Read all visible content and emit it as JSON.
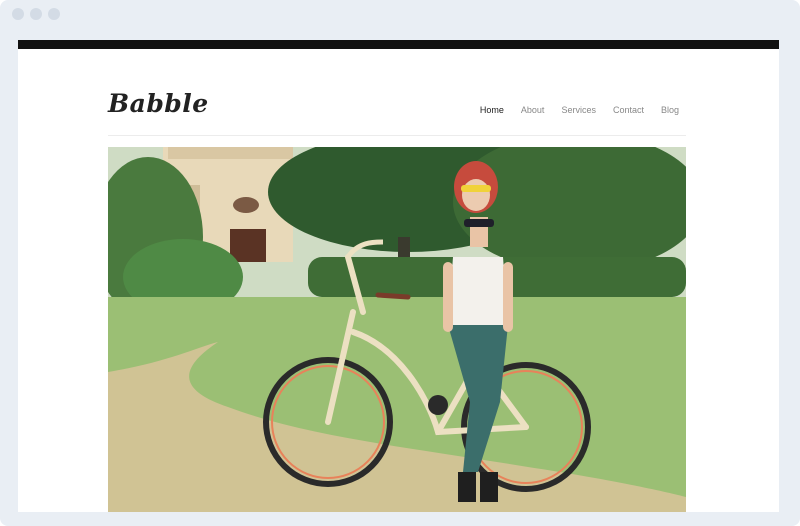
{
  "window": {
    "controls": [
      "close",
      "minimize",
      "maximize"
    ]
  },
  "site": {
    "logo": "Babble"
  },
  "nav": {
    "items": [
      {
        "label": "Home",
        "active": true
      },
      {
        "label": "About",
        "active": false
      },
      {
        "label": "Services",
        "active": false
      },
      {
        "label": "Contact",
        "active": false
      },
      {
        "label": "Blog",
        "active": false
      }
    ]
  },
  "hero": {
    "subject": "woman with red hair and yellow glasses leaning on a cream beach cruiser bicycle in a park",
    "colors": {
      "sky": "#dce8d2",
      "grass": "#9bbf74",
      "trees": "#2f5a2e",
      "bike": "#ece0c2",
      "hair": "#c64b3d"
    }
  },
  "colors": {
    "frame": "#e9eef4",
    "topbar": "#111111",
    "nav_active": "#222222",
    "nav_inactive": "#888888"
  }
}
